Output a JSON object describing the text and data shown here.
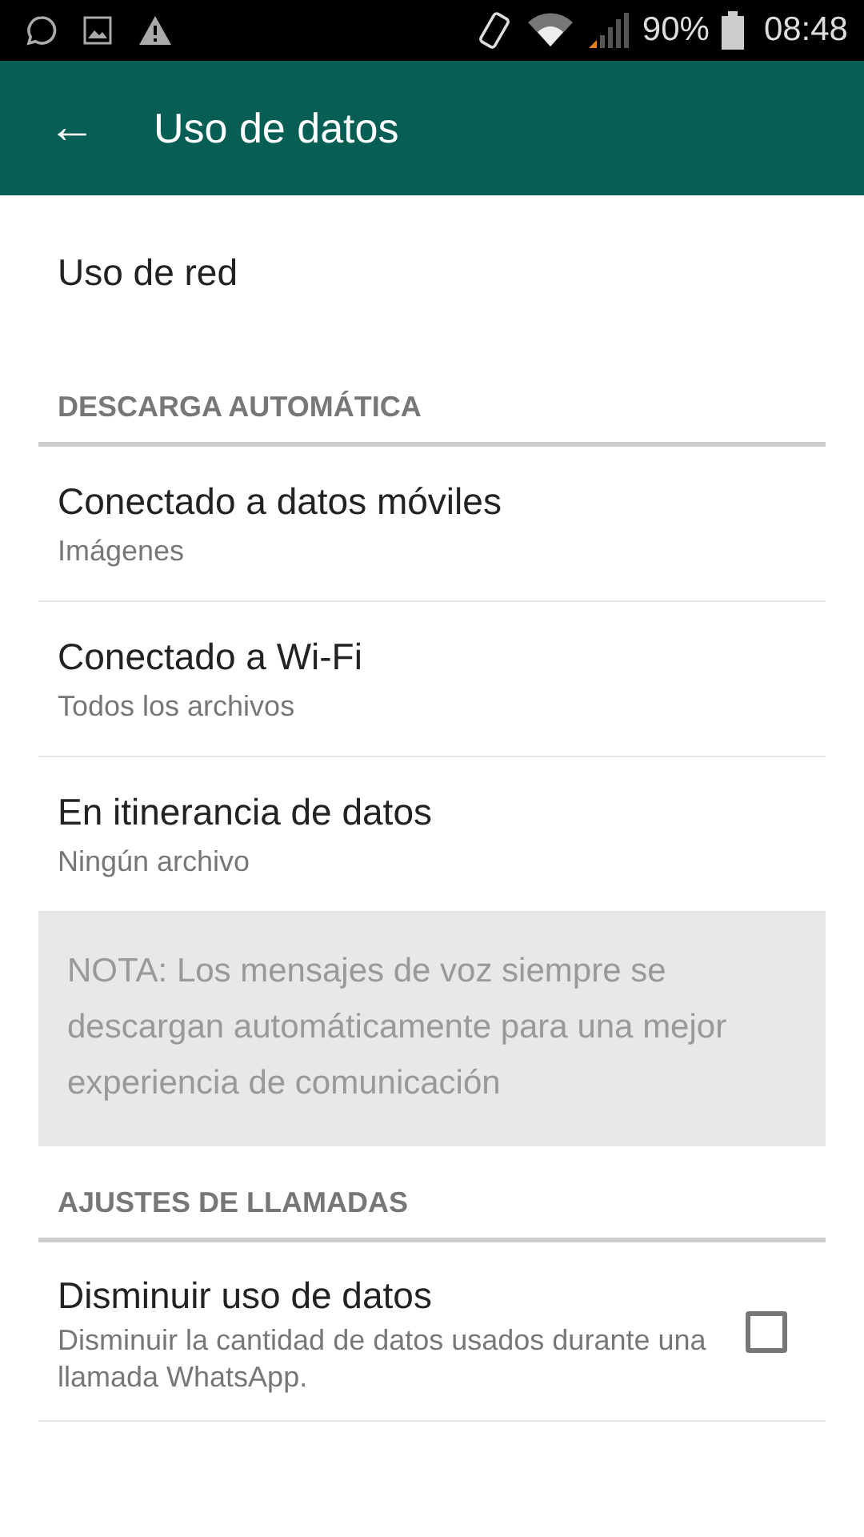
{
  "status_bar": {
    "battery": "90%",
    "time": "08:48"
  },
  "app_bar": {
    "back": "←",
    "title": "Uso de datos"
  },
  "sections": [
    {
      "items": [
        {
          "kind": "plain",
          "title": "Uso de red"
        }
      ]
    },
    {
      "header": "DESCARGA AUTOMÁTICA",
      "items": [
        {
          "kind": "subtitle",
          "title": "Conectado a datos móviles",
          "subtitle": "Imágenes"
        },
        {
          "kind": "subtitle",
          "title": "Conectado a Wi-Fi",
          "subtitle": "Todos los archivos"
        },
        {
          "kind": "subtitle",
          "title": "En itinerancia de datos",
          "subtitle": "Ningún archivo"
        },
        {
          "kind": "note",
          "text": "NOTA: Los mensajes de voz siempre se descargan automáticamente para una mejor experiencia de comunicación"
        }
      ]
    },
    {
      "header": "AJUSTES DE LLAMADAS",
      "items": [
        {
          "kind": "checkbox",
          "title": "Disminuir uso de datos",
          "subtitle": "Disminuir la cantidad de datos usados durante una llamada WhatsApp.",
          "checked": false
        }
      ]
    }
  ]
}
